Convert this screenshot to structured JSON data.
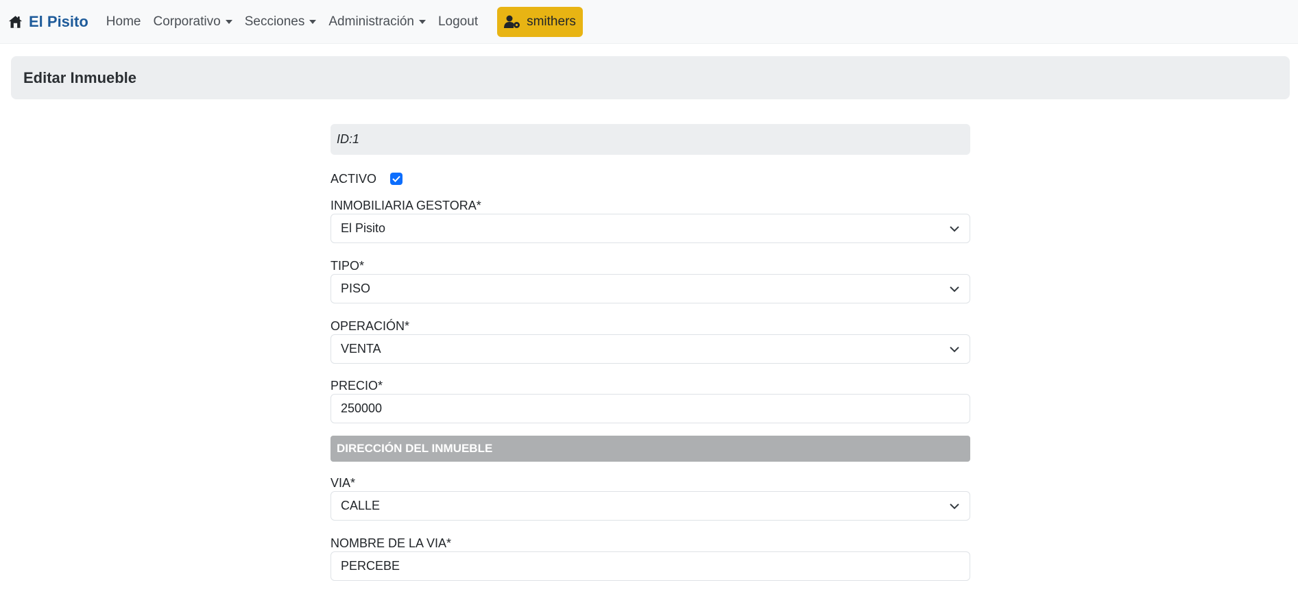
{
  "navbar": {
    "brand": "El Pisito",
    "links": [
      "Home",
      "Corporativo",
      "Secciones",
      "Administración",
      "Logout"
    ],
    "user": "smithers"
  },
  "page": {
    "title": "Editar Inmueble"
  },
  "form": {
    "id_text": "ID:1",
    "activo_label": "ACTIVO",
    "activo_checked": true,
    "inmobiliaria_label": "INMOBILIARIA GESTORA*",
    "inmobiliaria_value": "El Pisito",
    "tipo_label": "TIPO*",
    "tipo_value": "PISO",
    "operacion_label": "OPERACIÓN*",
    "operacion_value": "VENTA",
    "precio_label": "PRECIO*",
    "precio_value": "250000",
    "section_direccion": "DIRECCIÓN DEL INMUEBLE",
    "via_label": "VIA*",
    "via_value": "CALLE",
    "nombre_via_label": "NOMBRE DE LA VIA*",
    "nombre_via_value": "PERCEBE"
  },
  "colors": {
    "brand": "#1e5b9a",
    "user_button": "#e8b413",
    "checkbox": "#0d6efd",
    "section_bar": "#adafb1"
  },
  "icons": {
    "brand": "house-icon",
    "user": "user-gear-icon",
    "select": "chevron-down-icon"
  }
}
